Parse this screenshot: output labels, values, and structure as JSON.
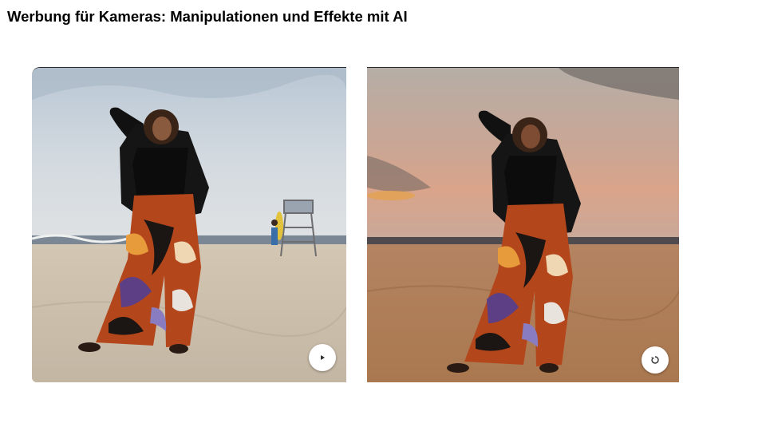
{
  "slide": {
    "title": "Werbung für Kameras: Manipulationen und Effekte mit AI"
  },
  "images": {
    "before": {
      "scene": "beach-daylight",
      "button_icon": "play-icon"
    },
    "after": {
      "scene": "beach-sunset",
      "button_icon": "reset-icon"
    }
  },
  "colors": {
    "title": "#000000",
    "before_sky": "#c9d3dc",
    "after_sky": "#c8a89a",
    "sand_before": "#cbbfae",
    "sand_after": "#b07e5c"
  }
}
